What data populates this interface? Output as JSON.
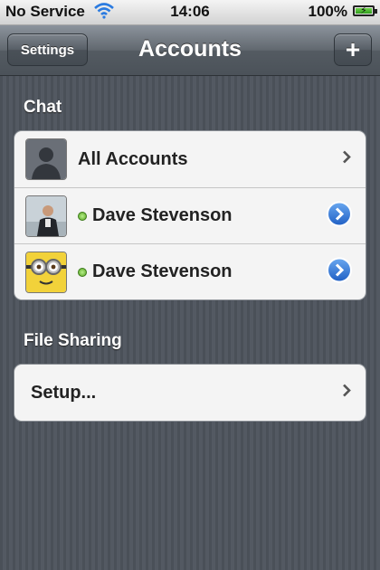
{
  "status_bar": {
    "carrier": "No Service",
    "time": "14:06",
    "battery": "100%",
    "battery_level": 1.0
  },
  "nav": {
    "title": "Accounts",
    "left_button": "Settings",
    "right_button": "+"
  },
  "sections": {
    "chat": {
      "header": "Chat",
      "rows": [
        {
          "label": "All Accounts",
          "icon": "default-avatar-icon",
          "accessory": "chevron-right-icon"
        },
        {
          "label": "Dave Stevenson",
          "icon": "photo-avatar-icon",
          "status": "online",
          "accessory": "detail-disclosure-icon"
        },
        {
          "label": "Dave Stevenson",
          "icon": "minion-avatar-icon",
          "status": "online",
          "accessory": "detail-disclosure-icon"
        }
      ]
    },
    "file_sharing": {
      "header": "File Sharing",
      "rows": [
        {
          "label": "Setup...",
          "accessory": "chevron-right-icon"
        }
      ]
    }
  },
  "colors": {
    "online": "#5aa524",
    "disclosure_blue": "#2a6fd6",
    "background": "#4d535b"
  }
}
